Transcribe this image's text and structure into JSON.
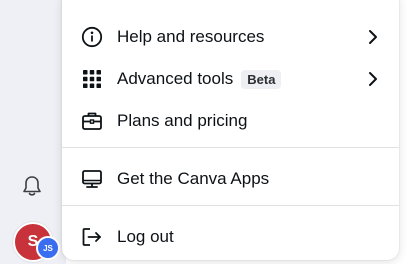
{
  "menu": {
    "items": [
      {
        "label": "Help and resources",
        "icon": "info-icon",
        "has_submenu": true
      },
      {
        "label": "Advanced tools",
        "icon": "grid-dots-icon",
        "badge": "Beta",
        "has_submenu": true
      },
      {
        "label": "Plans and pricing",
        "icon": "briefcase-icon"
      },
      {
        "label": "Get the Canva Apps",
        "icon": "monitor-icon"
      },
      {
        "label": "Log out",
        "icon": "logout-icon"
      }
    ]
  },
  "sidebar": {
    "notification_icon": "bell-icon",
    "avatar_initial": "S",
    "avatar_sub_initials": "JS"
  },
  "colors": {
    "rail_background": "#eef0f6",
    "avatar": "#c8323a",
    "avatar_sub": "#3a6df0"
  }
}
